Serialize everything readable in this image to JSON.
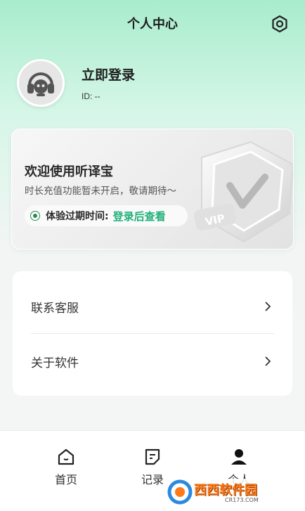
{
  "header": {
    "title": "个人中心",
    "settings_icon": "gear-icon"
  },
  "profile": {
    "avatar_icon": "headset-avatar-icon",
    "login_label": "立即登录",
    "id_label": "ID: --"
  },
  "vip_card": {
    "welcome": "欢迎使用听译宝",
    "description": "时长充值功能暂未开启，敬请期待～",
    "expire_label": "体验过期时间:",
    "expire_link": "登录后查看",
    "badge_text": "VIP",
    "accent_color": "#21b07a"
  },
  "menu": {
    "items": [
      {
        "label": "联系客服",
        "icon": "chevron-right-icon"
      },
      {
        "label": "关于软件",
        "icon": "chevron-right-icon"
      }
    ]
  },
  "bottom_nav": {
    "items": [
      {
        "label": "首页",
        "icon": "home-icon"
      },
      {
        "label": "记录",
        "icon": "document-icon"
      },
      {
        "label": "个人",
        "icon": "user-icon",
        "active": true
      }
    ]
  },
  "watermark": {
    "text": "西西软件园",
    "sub": "CR173.COM"
  }
}
